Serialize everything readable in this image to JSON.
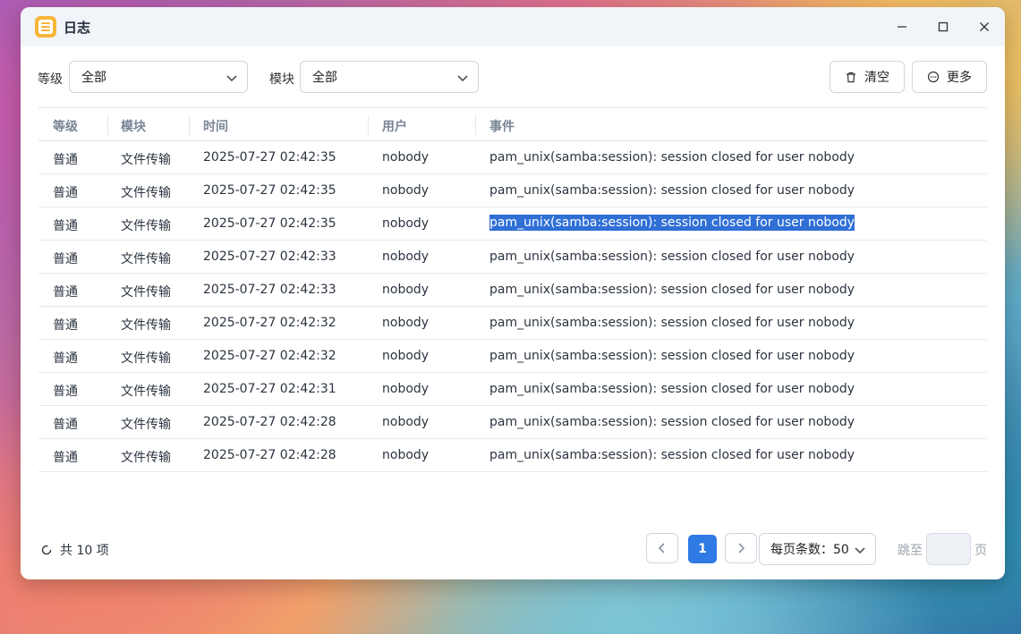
{
  "window": {
    "title": "日志"
  },
  "filters": {
    "level_label": "等级",
    "level_value": "全部",
    "module_label": "模块",
    "module_value": "全部"
  },
  "toolbar": {
    "clear_label": "清空",
    "more_label": "更多"
  },
  "table": {
    "columns": [
      "等级",
      "模块",
      "时间",
      "用户",
      "事件"
    ],
    "rows": [
      {
        "level": "普通",
        "module": "文件传输",
        "time": "2025-07-27 02:42:35",
        "user": "nobody",
        "event": "pam_unix(samba:session): session closed for user nobody"
      },
      {
        "level": "普通",
        "module": "文件传输",
        "time": "2025-07-27 02:42:35",
        "user": "nobody",
        "event": "pam_unix(samba:session): session closed for user nobody"
      },
      {
        "level": "普通",
        "module": "文件传输",
        "time": "2025-07-27 02:42:35",
        "user": "nobody",
        "event": "pam_unix(samba:session): session closed for user nobody"
      },
      {
        "level": "普通",
        "module": "文件传输",
        "time": "2025-07-27 02:42:33",
        "user": "nobody",
        "event": "pam_unix(samba:session): session closed for user nobody"
      },
      {
        "level": "普通",
        "module": "文件传输",
        "time": "2025-07-27 02:42:33",
        "user": "nobody",
        "event": "pam_unix(samba:session): session closed for user nobody"
      },
      {
        "level": "普通",
        "module": "文件传输",
        "time": "2025-07-27 02:42:32",
        "user": "nobody",
        "event": "pam_unix(samba:session): session closed for user nobody"
      },
      {
        "level": "普通",
        "module": "文件传输",
        "time": "2025-07-27 02:42:32",
        "user": "nobody",
        "event": "pam_unix(samba:session): session closed for user nobody"
      },
      {
        "level": "普通",
        "module": "文件传输",
        "time": "2025-07-27 02:42:31",
        "user": "nobody",
        "event": "pam_unix(samba:session): session closed for user nobody"
      },
      {
        "level": "普通",
        "module": "文件传输",
        "time": "2025-07-27 02:42:28",
        "user": "nobody",
        "event": "pam_unix(samba:session): session closed for user nobody"
      },
      {
        "level": "普通",
        "module": "文件传输",
        "time": "2025-07-27 02:42:28",
        "user": "nobody",
        "event": "pam_unix(samba:session): session closed for user nobody"
      }
    ],
    "selected_row": 2
  },
  "footer": {
    "total_label": "共 10 项",
    "current_page": "1",
    "page_size_label": "每页条数：50",
    "jump_label": "跳至",
    "jump_value": "",
    "page_suffix": "页"
  },
  "colors": {
    "accent": "#2f7ae5",
    "selection": "#2f6fd6",
    "app_icon": "#f6b53a"
  },
  "icons": {
    "app": "log-app-icon",
    "minimize": "minimize-icon",
    "maximize": "maximize-icon",
    "close": "close-icon",
    "clear": "trash-icon",
    "more": "more-circle-icon",
    "refresh": "refresh-icon",
    "prev": "chevron-left-icon",
    "next": "chevron-right-icon"
  }
}
